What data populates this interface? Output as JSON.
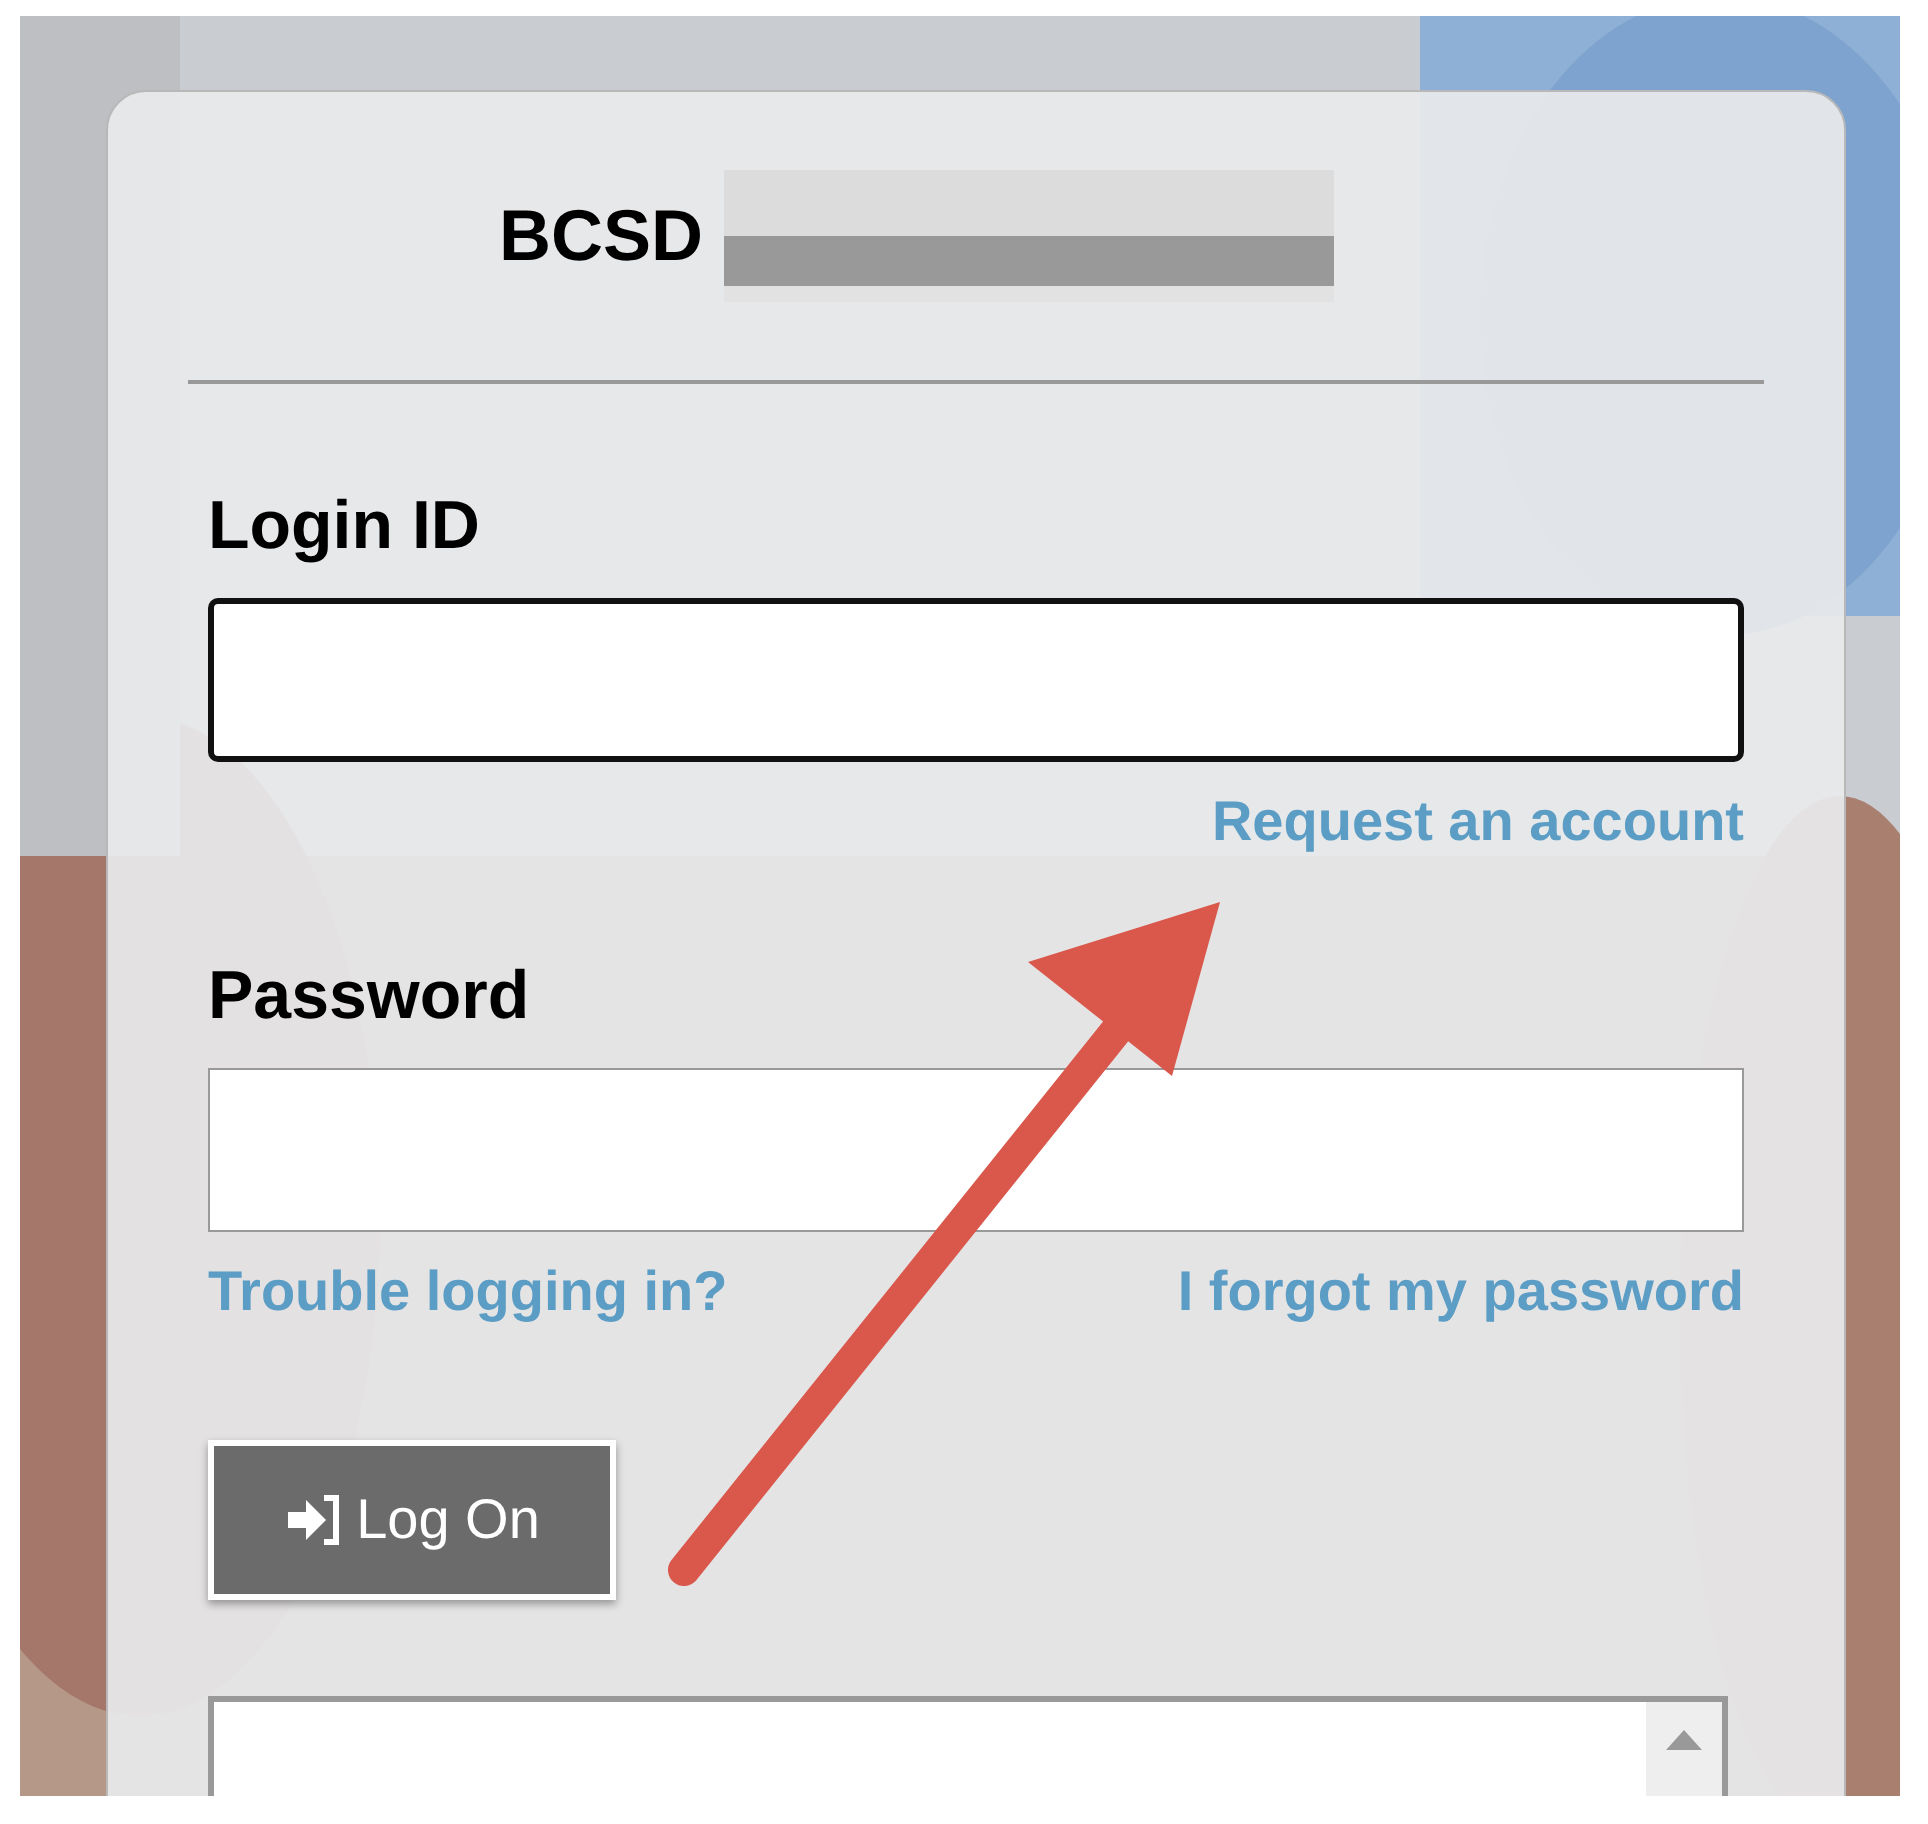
{
  "header": {
    "title": "BCSD",
    "redacted": true
  },
  "login_id": {
    "label": "Login ID",
    "focused": true
  },
  "request_link": "Request an account",
  "password": {
    "label": "Password"
  },
  "links": [
    "Trouble logging in?",
    "I forgot my password"
  ],
  "button": {
    "label": "Log On"
  },
  "annotation": {
    "kind": "arrow"
  }
}
